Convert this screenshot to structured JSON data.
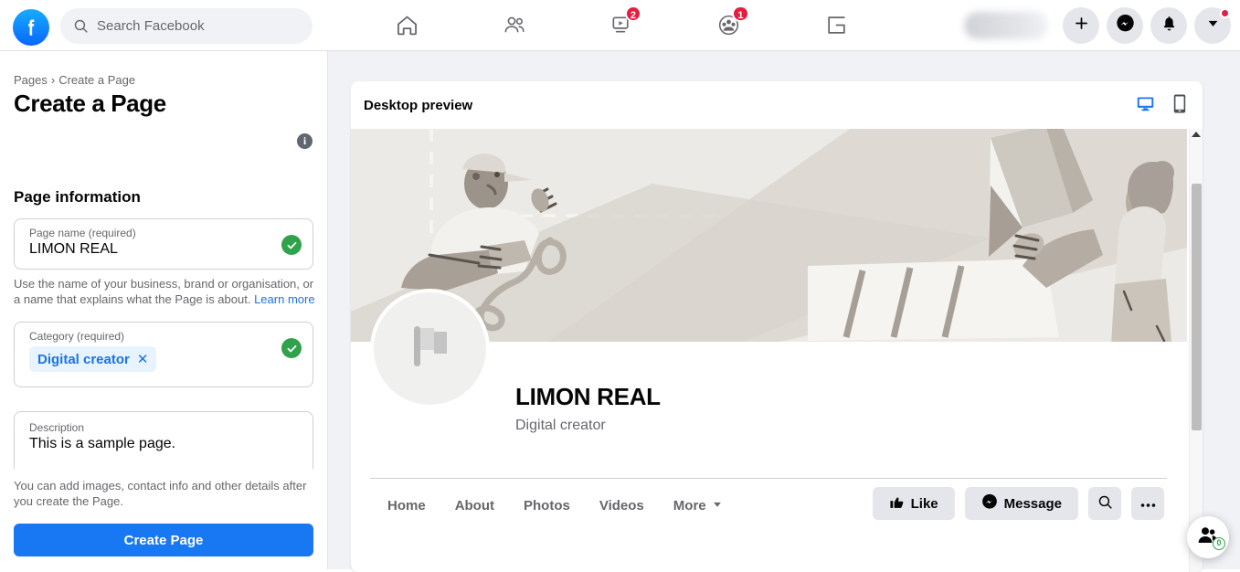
{
  "topbar": {
    "logo_icon": "facebook-logo",
    "search": {
      "placeholder": "Search Facebook",
      "icon": "search-icon"
    },
    "nav": [
      {
        "name": "home",
        "icon": "home-icon",
        "badge": ""
      },
      {
        "name": "friends",
        "icon": "friends-icon",
        "badge": ""
      },
      {
        "name": "watch",
        "icon": "video-icon",
        "badge": "2"
      },
      {
        "name": "groups",
        "icon": "groups-icon",
        "badge": "1"
      },
      {
        "name": "gaming",
        "icon": "gaming-icon",
        "badge": ""
      }
    ],
    "right": [
      {
        "name": "create",
        "icon": "plus-icon"
      },
      {
        "name": "messenger",
        "icon": "messenger-icon"
      },
      {
        "name": "notifications",
        "icon": "bell-icon"
      },
      {
        "name": "account",
        "icon": "chevron-down-icon"
      }
    ]
  },
  "sidebar": {
    "breadcrumb_root": "Pages",
    "breadcrumb_sep": "›",
    "breadcrumb_current": "Create a Page",
    "title": "Create a Page",
    "info_icon_label": "i",
    "section_title": "Page information",
    "page_name": {
      "label": "Page name (required)",
      "value": "LIMON REAL",
      "valid": true
    },
    "page_name_helper": "Use the name of your business, brand or organisation, or a name that explains what the Page is about.",
    "page_name_helper_link": "Learn more",
    "category": {
      "label": "Category (required)",
      "chip": "Digital creator",
      "chip_remove": "✕",
      "valid": true
    },
    "description": {
      "label": "Description",
      "value": "This is a sample page."
    },
    "bottom_note": "You can add images, contact info and other details after you create the Page.",
    "create_button": "Create Page"
  },
  "preview": {
    "header_title": "Desktop preview",
    "device_desktop_icon": "desktop-icon",
    "device_mobile_icon": "mobile-icon",
    "device_active": "desktop",
    "cover_alt": "illustration-people-carrying-banner",
    "avatar_icon": "flag-placeholder-icon",
    "page_name": "LIMON REAL",
    "page_category": "Digital creator",
    "tabs": [
      {
        "label": "Home",
        "has_caret": false
      },
      {
        "label": "About",
        "has_caret": false
      },
      {
        "label": "Photos",
        "has_caret": false
      },
      {
        "label": "Videos",
        "has_caret": false
      },
      {
        "label": "More",
        "has_caret": true
      }
    ],
    "actions": [
      {
        "label": "Like",
        "icon": "thumbs-up-icon"
      },
      {
        "label": "Message",
        "icon": "messenger-icon"
      },
      {
        "label": "",
        "icon": "search-icon"
      },
      {
        "label": "",
        "icon": "ellipsis-icon"
      }
    ]
  },
  "fab": {
    "icon": "contacts-icon",
    "badge": "0"
  },
  "colors": {
    "brand_blue": "#1877f2",
    "link_blue": "#216fdb",
    "valid_green": "#31a24c",
    "badge_red": "#e41e3f",
    "chip_bg": "#e7f3ff",
    "page_bg": "#f0f2f5"
  }
}
